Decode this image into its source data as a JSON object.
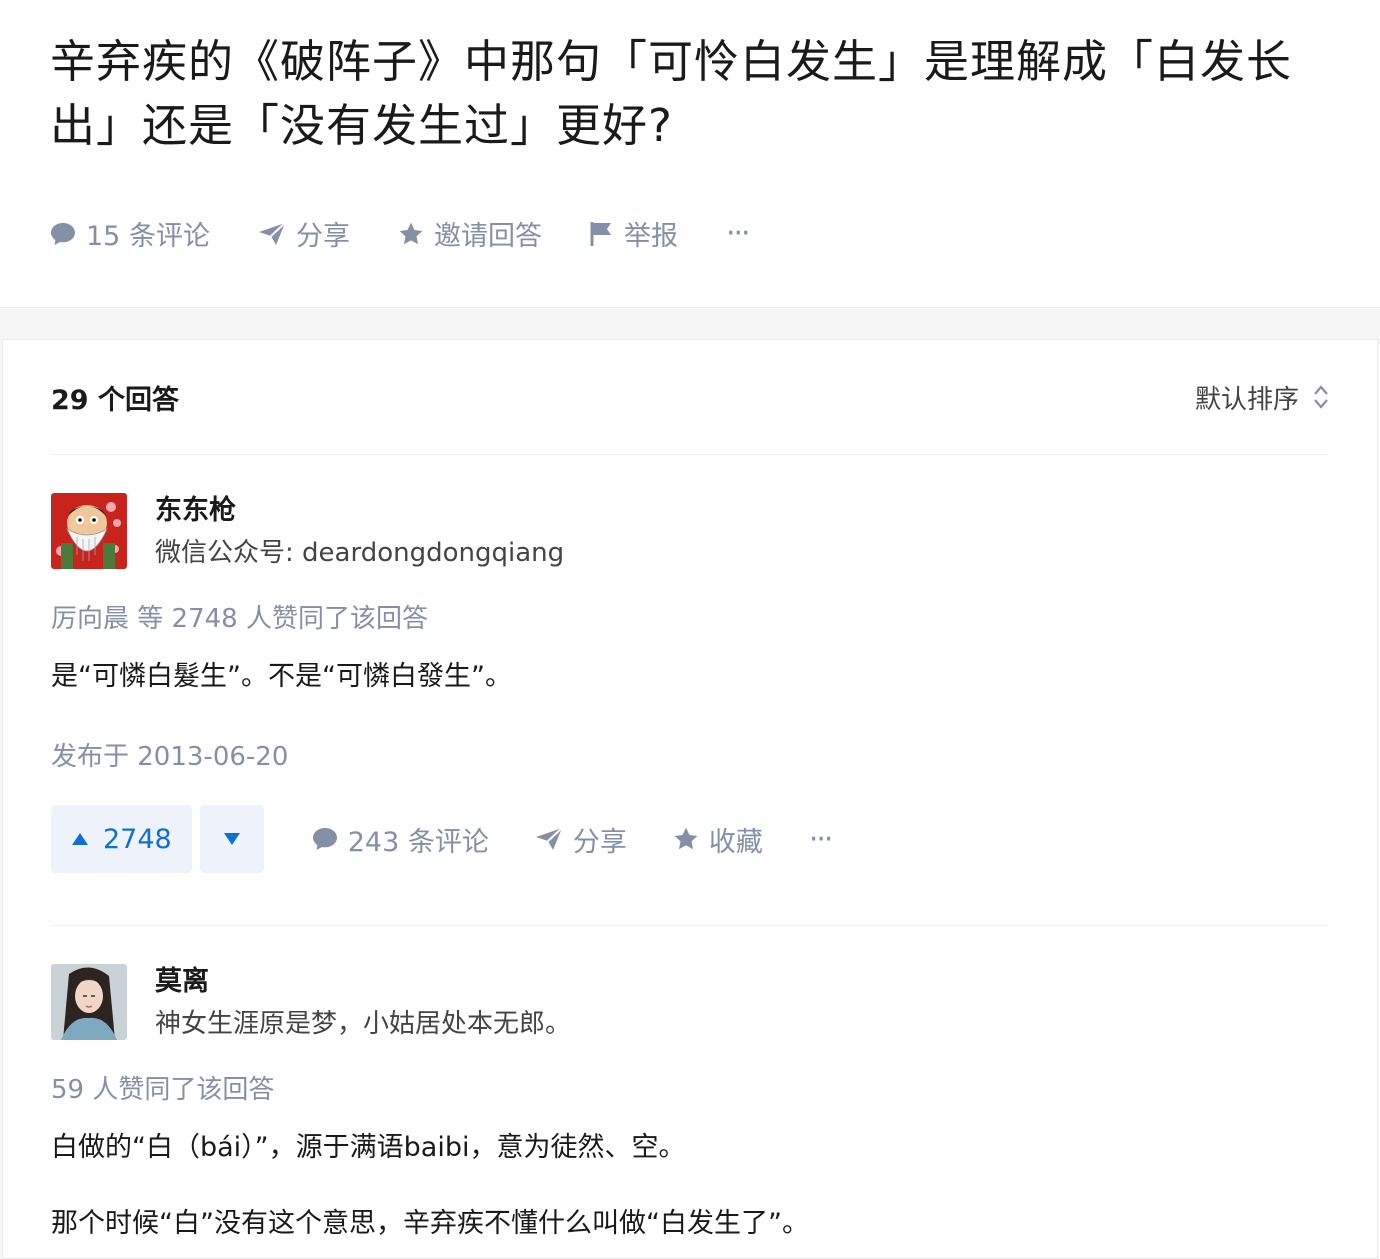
{
  "question": {
    "title": "辛弃疾的《破阵子》中那句「可怜白发生」是理解成「白发长出」还是「没有发生过」更好?",
    "actions": {
      "comments": "15 条评论",
      "share": "分享",
      "invite": "邀请回答",
      "report": "举报",
      "more": "···"
    }
  },
  "answers_header": {
    "count": "29 个回答",
    "sort": "默认排序"
  },
  "answers": [
    {
      "author": "东东枪",
      "bio": "微信公众号: deardongdongqiang",
      "votes_line": "厉向晨 等 2748 人赞同了该回答",
      "content": [
        "是“可憐白髮生”。不是“可憐白發生”。"
      ],
      "date": "发布于 2013-06-20",
      "upvotes": "2748",
      "comments": "243 条评论",
      "share": "分享",
      "collect": "收藏",
      "more": "···"
    },
    {
      "author": "莫离",
      "bio": "神女生涯原是梦，小姑居处本无郎。",
      "votes_line": "59 人赞同了该回答",
      "content": [
        "白做的“白（bái）”，源于满语baibi，意为徒然、空。",
        "那个时候“白”没有这个意思，辛弃疾不懂什么叫做“白发生了”。"
      ]
    }
  ],
  "colors": {
    "meta_gray": "#8590a6",
    "vote_blue": "#0f6fd2",
    "vote_bg": "#eef3fb"
  }
}
